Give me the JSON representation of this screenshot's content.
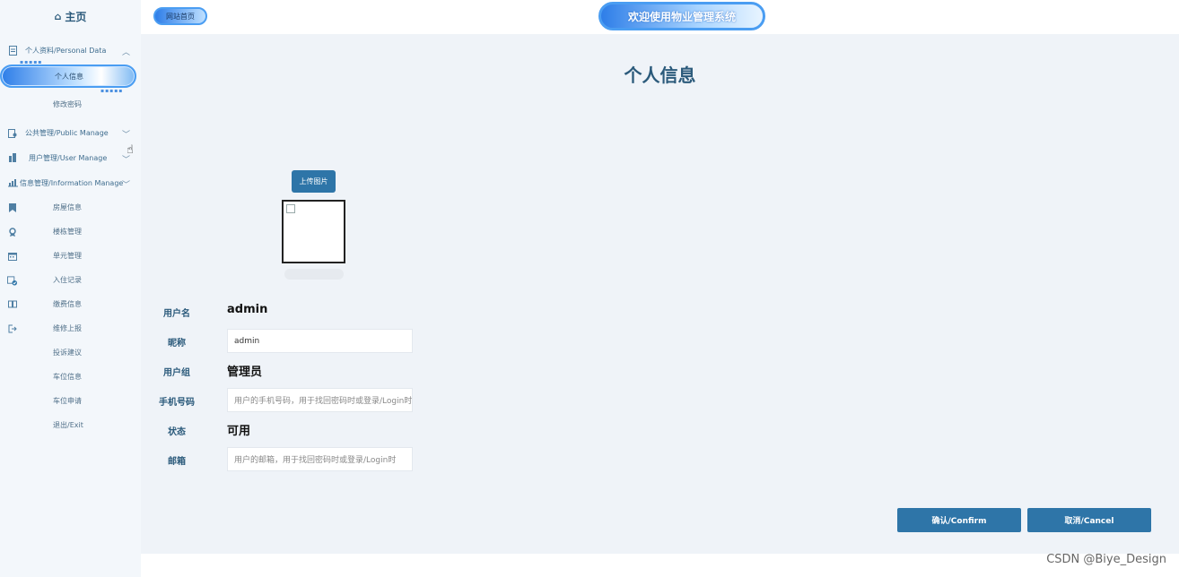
{
  "sidebar": {
    "home": "主页",
    "groups": [
      {
        "label": "个人资料/Personal Data",
        "icon": "document-icon"
      },
      {
        "label": "公共管理/Public Manage",
        "icon": "clipboard-icon"
      },
      {
        "label": "用户管理/User Manage",
        "icon": "building-icon"
      },
      {
        "label": "信息管理/Information Manage",
        "icon": "chart-icon"
      }
    ],
    "personal_items": [
      "个人信息",
      "修改密码"
    ],
    "info_items": [
      {
        "label": "房屋信息",
        "icon": "bookmark-icon"
      },
      {
        "label": "楼栋管理",
        "icon": "badge-icon"
      },
      {
        "label": "单元管理",
        "icon": "calendar-icon"
      },
      {
        "label": "入住记录",
        "icon": "calendar-check-icon"
      },
      {
        "label": "缴费信息",
        "icon": "book-icon"
      },
      {
        "label": "维修上报",
        "icon": "logout-icon"
      },
      {
        "label": "投诉建议",
        "icon": ""
      },
      {
        "label": "车位信息",
        "icon": ""
      },
      {
        "label": "车位申请",
        "icon": ""
      },
      {
        "label": "退出/Exit",
        "icon": ""
      }
    ]
  },
  "topbar": {
    "site_home": "网站首页",
    "welcome": "欢迎使用物业管理系统"
  },
  "main": {
    "title": "个人信息",
    "upload_button": "上传图片",
    "fields": {
      "username_label": "用户名",
      "username_value": "admin",
      "nickname_label": "昵称",
      "nickname_value": "admin",
      "group_label": "用户组",
      "group_value": "管理员",
      "phone_label": "手机号码",
      "phone_placeholder": "用户的手机号码，用于找回密码时或登录/Login时",
      "status_label": "状态",
      "status_value": "可用",
      "email_label": "邮箱",
      "email_placeholder": "用户的邮箱，用于找回密码时或登录/Login时"
    },
    "confirm_button": "确认/Confirm",
    "cancel_button": "取消/Cancel"
  },
  "watermark": "CSDN @Biye_Design"
}
